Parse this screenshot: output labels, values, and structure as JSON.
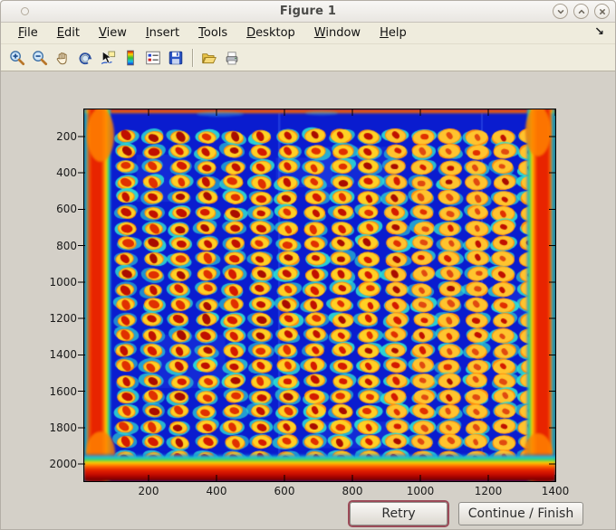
{
  "window": {
    "title": "Figure 1",
    "controls": [
      "shade",
      "maximize",
      "close"
    ]
  },
  "menu": {
    "items": [
      "File",
      "Edit",
      "View",
      "Insert",
      "Tools",
      "Desktop",
      "Window",
      "Help"
    ],
    "dock_glyph": "↘"
  },
  "toolbar": {
    "items": [
      "zoom-in",
      "zoom-out",
      "pan",
      "rotate-3d",
      "data-cursor",
      "insert-colorbar",
      "insert-legend",
      "save-figure",
      "separator",
      "open-file",
      "print-figure"
    ]
  },
  "figure": {
    "axes": {
      "x_tick_labels": [
        "200",
        "400",
        "600",
        "800",
        "1000",
        "1200",
        "1400"
      ],
      "y_tick_labels": [
        "200",
        "400",
        "600",
        "800",
        "1000",
        "1200",
        "1400",
        "1600",
        "1800",
        "2000"
      ],
      "x_range": [
        1,
        1400
      ],
      "y_range": [
        1,
        2048
      ]
    },
    "image": {
      "type": "heatmap-photo",
      "colormap": "jet",
      "description": "jet-colormapped camera image of a dot-blot microplate: blue field, warm red borders, regular grid of spots with red centers, yellow rings and cyan halos",
      "grid": {
        "rows": 22,
        "cols": 16
      },
      "colors": {
        "field": "#0a1ccf",
        "seam_light": "rgba(80,130,255,0.30)",
        "halo": "#2ee0d2",
        "ring_yellow": "#ffd024",
        "ring_yellow_right": "#ffc42e",
        "ring_orange": "#ff9010",
        "center_reds": [
          "#d41a00",
          "#c01000",
          "#a80c00",
          "#e03000"
        ],
        "center_orange_right": "#e04a10",
        "edge_red": "#e82400",
        "edge_orange": "#ff7a00",
        "edge_yellow": "#ffd800",
        "edge_green": "#3fd060",
        "edge_cyan": "#19c4e8",
        "bottom_dark": "#8f0000",
        "bottom_darkest": "#6e0000"
      }
    }
  },
  "buttons": {
    "retry": "Retry",
    "continue": "Continue / Finish"
  }
}
